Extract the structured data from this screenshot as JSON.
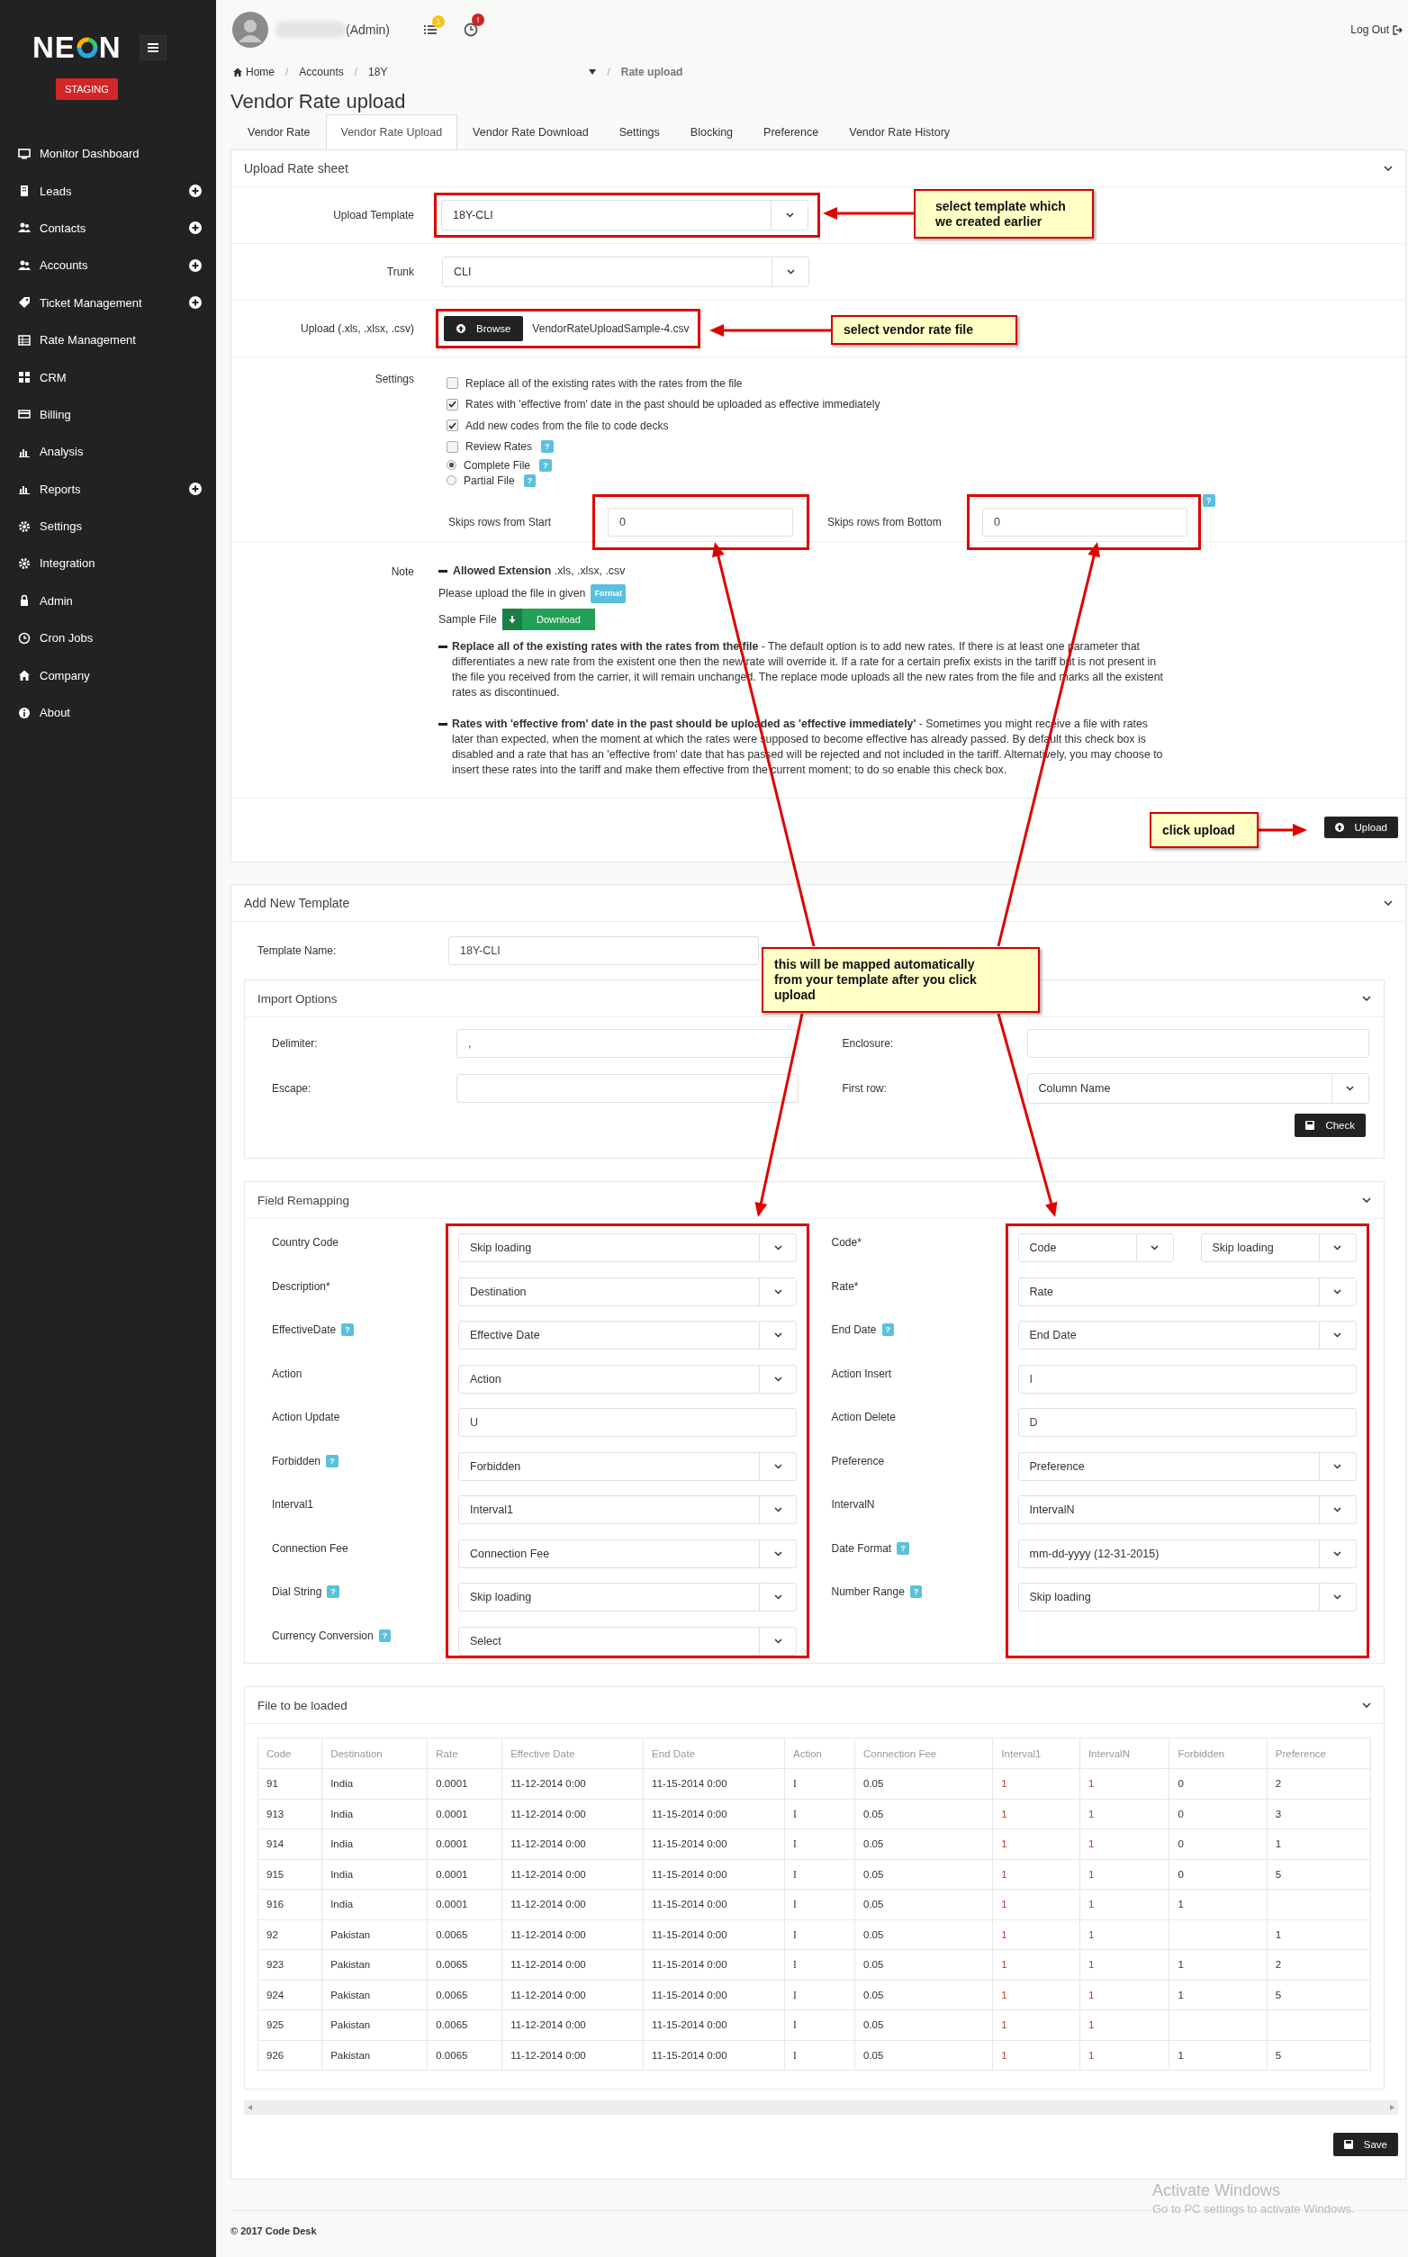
{
  "sidebar": {
    "logo_start": "NE",
    "logo_end": "N",
    "badge": "STAGING",
    "menu": [
      {
        "label": "Monitor Dashboard",
        "has_add": false
      },
      {
        "label": "Leads",
        "has_add": true
      },
      {
        "label": "Contacts",
        "has_add": true
      },
      {
        "label": "Accounts",
        "has_add": true
      },
      {
        "label": "Ticket Management",
        "has_add": true
      },
      {
        "label": "Rate Management",
        "has_add": false
      },
      {
        "label": "CRM",
        "has_add": false
      },
      {
        "label": "Billing",
        "has_add": false
      },
      {
        "label": "Analysis",
        "has_add": false
      },
      {
        "label": "Reports",
        "has_add": true
      },
      {
        "label": "Settings",
        "has_add": false
      },
      {
        "label": "Integration",
        "has_add": false
      },
      {
        "label": "Admin",
        "has_add": false
      },
      {
        "label": "Cron Jobs",
        "has_add": false
      },
      {
        "label": "Company",
        "has_add": false
      },
      {
        "label": "About",
        "has_add": false
      }
    ]
  },
  "header": {
    "user_role": "(Admin)",
    "task_count": "1",
    "alert_count": "!",
    "logout": "Log Out"
  },
  "breadcrumb_separator": "/",
  "breadcrumb": [
    {
      "label": "Home",
      "current": false
    },
    {
      "label": "Accounts",
      "current": false
    },
    {
      "label": "18Y",
      "current": false
    },
    {
      "label": "Rate upload",
      "current": true
    }
  ],
  "page_title": "Vendor Rate upload",
  "tabs": [
    {
      "label": "Vendor Rate",
      "selected": false
    },
    {
      "label": "Vendor Rate Upload",
      "selected": true
    },
    {
      "label": "Vendor Rate Download",
      "selected": false
    },
    {
      "label": "Settings",
      "selected": false
    },
    {
      "label": "Blocking",
      "selected": false
    },
    {
      "label": "Preference",
      "selected": false
    },
    {
      "label": "Vendor Rate History",
      "selected": false
    }
  ],
  "upload_panel": {
    "title": "Upload Rate sheet",
    "template": {
      "label": "Upload Template",
      "value": "18Y-CLI"
    },
    "trunk": {
      "label": "Trunk",
      "value": "CLI"
    },
    "file": {
      "label": "Upload (.xls, .xlsx, .csv)",
      "button": "Browse",
      "filename": "VendorRateUploadSample-4.csv"
    },
    "settings": {
      "label": "Settings",
      "options": [
        {
          "kind": "checkbox",
          "label": "Replace all of the existing rates with the rates from the file",
          "checked": false
        },
        {
          "kind": "checkbox",
          "label": "Rates with 'effective from' date in the past should be uploaded as effective immediately",
          "checked": true
        },
        {
          "kind": "checkbox",
          "label": "Add new codes from the file to code decks",
          "checked": true
        },
        {
          "kind": "checkbox",
          "label": "Review Rates",
          "checked": false,
          "help": "?"
        },
        {
          "kind": "radio",
          "label": "Complete File",
          "checked": true,
          "help": "?"
        },
        {
          "kind": "radio",
          "label": "Partial File",
          "checked": false,
          "help": "?"
        }
      ],
      "skip_start": {
        "label": "Skips rows from Start",
        "value": "0"
      },
      "skip_bottom": {
        "label": "Skips rows from Bottom",
        "value": "0",
        "help": "?"
      }
    },
    "note": {
      "label": "Note",
      "allowed": "**Allowed Extension** .xls, .xlsx, .csv",
      "format_text": "Please upload the file in given",
      "format_badge": "Format",
      "sample_label": "Sample File",
      "download": "Download",
      "paragraphs": [
        "**Replace all of the existing rates with the rates from the file** - The default option is to add new rates. If there is at least one parameter that differentiates a new rate from the existent one then the new rate will override it. If a rate for a certain prefix exists in the tariff but is not present in the file you received from the carrier, it will remain unchanged. The replace mode uploads all the new rates from the file and marks all the existent rates as discontinued.",
        "**Rates with 'effective from' date in the past should be uploaded as 'effective immediately'** - Sometimes you might receive a file with rates later than expected, when the moment at which the rates were supposed to become effective has already passed. By default this check box is disabled and a rate that has an 'effective from' date that has passed will be rejected and not included in the tariff. Alternatively, you may choose to insert these rates into the tariff and make them effective from the current moment; to do so enable this check box."
      ]
    },
    "upload_button": "Upload"
  },
  "template_panel": {
    "title": "Add New Template",
    "name_label": "Template Name:",
    "name_value": "18Y-CLI",
    "import": {
      "title": "Import Options",
      "fields": [
        {
          "label": "Delimiter:",
          "kind": "input",
          "value": ","
        },
        {
          "label": "Enclosure:",
          "kind": "input"
        },
        {
          "label": "Escape:",
          "kind": "input"
        },
        {
          "label": "First row:",
          "kind": "select",
          "value": "Column Name"
        }
      ],
      "check_button": "Check"
    }
  },
  "remap_panel": {
    "title": "Field Remapping",
    "left": [
      {
        "label": "Country Code",
        "kind": "select",
        "values": [
          "Skip loading"
        ]
      },
      {
        "label": "Description*",
        "kind": "select",
        "values": [
          "Destination"
        ]
      },
      {
        "label": "EffectiveDate",
        "help": "?",
        "kind": "select",
        "values": [
          "Effective Date"
        ]
      },
      {
        "label": "Action",
        "kind": "select",
        "values": [
          "Action"
        ]
      },
      {
        "label": "Action Update",
        "kind": "input",
        "values": [
          "U"
        ]
      },
      {
        "label": "Forbidden",
        "help": "?",
        "kind": "select",
        "values": [
          "Forbidden"
        ]
      },
      {
        "label": "Interval1",
        "kind": "select",
        "values": [
          "Interval1"
        ]
      },
      {
        "label": "Connection Fee",
        "kind": "select",
        "values": [
          "Connection Fee"
        ]
      },
      {
        "label": "Dial String",
        "help": "?",
        "kind": "select",
        "values": [
          "Skip loading"
        ]
      },
      {
        "label": "Currency Conversion",
        "help": "?",
        "kind": "select",
        "values": [
          "Select"
        ]
      }
    ],
    "right": [
      {
        "label": "Code*",
        "kind": "select",
        "values": [
          "Code",
          "Skip loading"
        ]
      },
      {
        "label": "Rate*",
        "kind": "select",
        "values": [
          "Rate"
        ]
      },
      {
        "label": "End Date",
        "help": "?",
        "kind": "select",
        "values": [
          "End Date"
        ]
      },
      {
        "label": "Action Insert",
        "kind": "input",
        "values": [
          "I"
        ]
      },
      {
        "label": "Action Delete",
        "kind": "input",
        "values": [
          "D"
        ]
      },
      {
        "label": "Preference",
        "kind": "select",
        "values": [
          "Preference"
        ]
      },
      {
        "label": "IntervalN",
        "kind": "select",
        "values": [
          "IntervalN"
        ]
      },
      {
        "label": "Date Format",
        "help": "?",
        "kind": "select",
        "values": [
          "mm-dd-yyyy (12-31-2015)"
        ]
      },
      {
        "label": "Number Range",
        "help": "?",
        "kind": "select",
        "values": [
          "Skip loading"
        ]
      }
    ]
  },
  "file_panel": {
    "title": "File to be loaded",
    "columns": [
      {
        "label": "Code",
        "kind": "plain"
      },
      {
        "label": "Destination",
        "kind": "plain"
      },
      {
        "label": "Rate",
        "kind": "plain"
      },
      {
        "label": "Effective Date",
        "kind": "plain"
      },
      {
        "label": "End Date",
        "kind": "plain"
      },
      {
        "label": "Action",
        "kind": "plain"
      },
      {
        "label": "Connection Fee",
        "kind": "plain"
      },
      {
        "label": "Interval1",
        "kind": "accent"
      },
      {
        "label": "IntervalN",
        "kind": "accent"
      },
      {
        "label": "Forbidden",
        "kind": "plain"
      },
      {
        "label": "Preference",
        "kind": "plain"
      }
    ],
    "rows": [
      [
        "91",
        "India",
        "0.0001",
        "11-12-2014 0:00",
        "11-15-2014 0:00",
        "I",
        "0.05",
        "1",
        "1",
        "0",
        "2"
      ],
      [
        "913",
        "India",
        "0.0001",
        "11-12-2014 0:00",
        "11-15-2014 0:00",
        "I",
        "0.05",
        "1",
        "1",
        "0",
        "3"
      ],
      [
        "914",
        "India",
        "0.0001",
        "11-12-2014 0:00",
        "11-15-2014 0:00",
        "I",
        "0.05",
        "1",
        "1",
        "0",
        "1"
      ],
      [
        "915",
        "India",
        "0.0001",
        "11-12-2014 0:00",
        "11-15-2014 0:00",
        "I",
        "0.05",
        "1",
        "1",
        "0",
        "5"
      ],
      [
        "916",
        "India",
        "0.0001",
        "11-12-2014 0:00",
        "11-15-2014 0:00",
        "I",
        "0.05",
        "1",
        "1",
        "1",
        null
      ],
      [
        "92",
        "Pakistan",
        "0.0065",
        "11-12-2014 0:00",
        "11-15-2014 0:00",
        "I",
        "0.05",
        "1",
        "1",
        null,
        "1"
      ],
      [
        "923",
        "Pakistan",
        "0.0065",
        "11-12-2014 0:00",
        "11-15-2014 0:00",
        "I",
        "0.05",
        "1",
        "1",
        "1",
        "2"
      ],
      [
        "924",
        "Pakistan",
        "0.0065",
        "11-12-2014 0:00",
        "11-15-2014 0:00",
        "I",
        "0.05",
        "1",
        "1",
        "1",
        "5"
      ],
      [
        "925",
        "Pakistan",
        "0.0065",
        "11-12-2014 0:00",
        "11-15-2014 0:00",
        "I",
        "0.05",
        "1",
        "1",
        null,
        null
      ],
      [
        "926",
        "Pakistan",
        "0.0065",
        "11-12-2014 0:00",
        "11-15-2014 0:00",
        "I",
        "0.05",
        "1",
        "1",
        "1",
        "5"
      ]
    ],
    "save_button": "Save"
  },
  "footer": "© 2017 Code Desk",
  "callouts": [
    {
      "text": "select template which we created earlier"
    },
    {
      "text": "select vendor rate file"
    },
    {
      "text": "click upload"
    },
    {
      "text": "this will be mapped automatically from your template after you click upload"
    }
  ],
  "os_notice": {
    "title": "Activate Windows",
    "text": "Go to PC settings to activate Windows."
  }
}
